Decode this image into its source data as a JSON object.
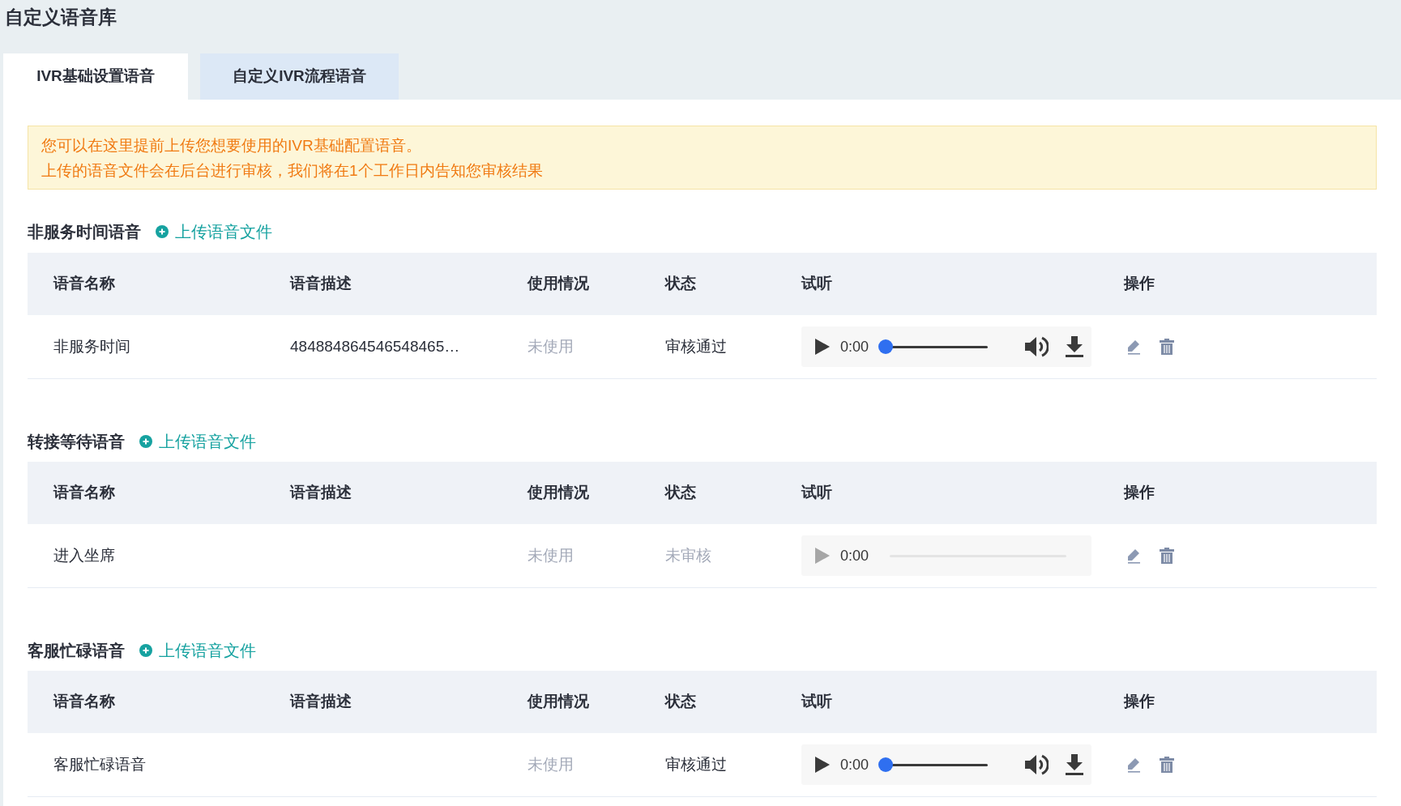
{
  "page_title": "自定义语音库",
  "tabs": [
    {
      "label": "IVR基础设置语音",
      "selected": true
    },
    {
      "label": "自定义IVR流程语音",
      "selected": false
    }
  ],
  "notice": [
    "您可以在这里提前上传您想要使用的IVR基础配置语音。",
    "上传的语音文件会在后台进行审核，我们将在1个工作日内告知您审核结果"
  ],
  "sections": [
    {
      "title": "非服务时间语音",
      "upload_link": "上传语音文件",
      "columns": [
        "语音名称",
        "语音描述",
        "使用情况",
        "状态",
        "试听",
        "操作"
      ],
      "rows": [
        {
          "name": "非服务时间",
          "description": "484884864546548465…",
          "usage": "未使用",
          "in_use": false,
          "status": "审核通过",
          "approved": true,
          "player": {
            "time": "0:00",
            "enabled": true,
            "level": 0
          }
        }
      ]
    },
    {
      "title": "转接等待语音",
      "upload_link": "上传语音文件",
      "columns": [
        "语音名称",
        "语音描述",
        "使用情况",
        "状态",
        "试听",
        "操作"
      ],
      "rows": [
        {
          "name": "进入坐席",
          "usage": "未使用",
          "in_use": false,
          "status": "未审核",
          "approved": false,
          "player": {
            "time": "0:00",
            "enabled": false
          }
        }
      ]
    },
    {
      "title": "客服忙碌语音",
      "upload_link": "上传语音文件",
      "columns": [
        "语音名称",
        "语音描述",
        "使用情况",
        "状态",
        "试听",
        "操作"
      ],
      "rows": [
        {
          "name": "客服忙碌语音",
          "usage": "未使用",
          "in_use": false,
          "status": "审核通过",
          "approved": true,
          "player": {
            "time": "0:00",
            "enabled": true,
            "level": 0
          }
        }
      ]
    }
  ]
}
